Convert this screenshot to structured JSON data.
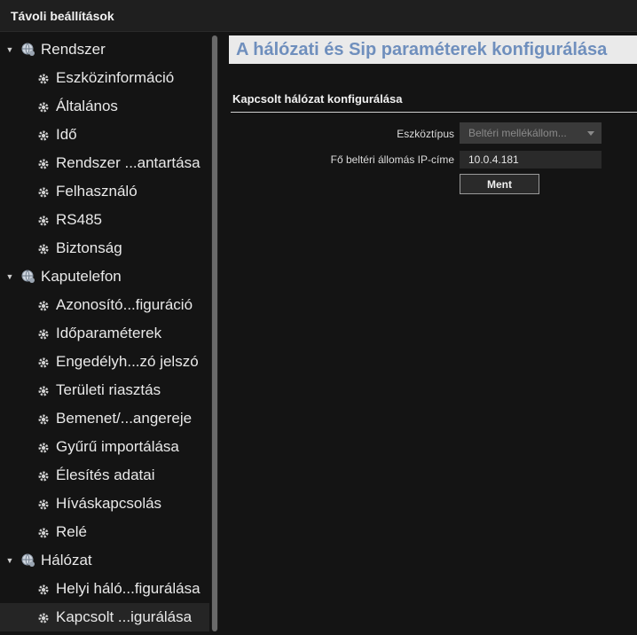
{
  "window": {
    "title": "Távoli beállítások"
  },
  "sidebar": {
    "groups": [
      {
        "label": "Rendszer",
        "items": [
          {
            "label": "Eszközinformáció"
          },
          {
            "label": "Általános"
          },
          {
            "label": "Idő"
          },
          {
            "label": "Rendszer ...antartása"
          },
          {
            "label": "Felhasználó"
          },
          {
            "label": "RS485"
          },
          {
            "label": "Biztonság"
          }
        ]
      },
      {
        "label": "Kaputelefon",
        "items": [
          {
            "label": "Azonosító...figuráció"
          },
          {
            "label": "Időparaméterek"
          },
          {
            "label": "Engedélyh...zó jelszó"
          },
          {
            "label": "Területi riasztás"
          },
          {
            "label": "Bemenet/...angereje"
          },
          {
            "label": "Gyűrű importálása"
          },
          {
            "label": "Élesítés adatai"
          },
          {
            "label": "Híváskapcsolás"
          },
          {
            "label": "Relé"
          }
        ]
      },
      {
        "label": "Hálózat",
        "items": [
          {
            "label": "Helyi háló...figurálása"
          },
          {
            "label": "Kapcsolt ...igurálása"
          }
        ]
      }
    ]
  },
  "main": {
    "heading": "A hálózati és Sip paraméterek konfigurálása",
    "section_title": "Kapcsolt hálózat konfigurálása",
    "device_type_label": "Eszköztípus",
    "device_type_value": "Beltéri mellékállom...",
    "ip_label": "Fő beltéri állomás IP-címe",
    "ip_value": "10.0.4.181",
    "save_label": "Ment"
  },
  "colors": {
    "heading_text": "#6f8fbd",
    "background": "#141414"
  }
}
